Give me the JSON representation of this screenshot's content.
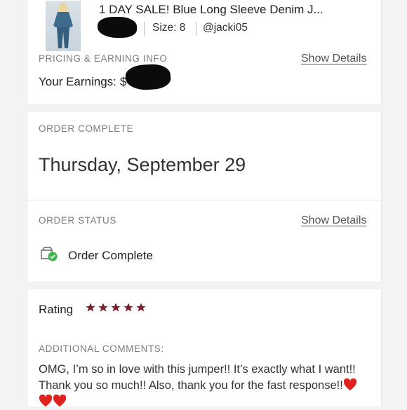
{
  "listing": {
    "title": "1 DAY SALE! Blue Long Sleeve Denim J...",
    "size": "Size: 8",
    "username": "@jacki05"
  },
  "pricing": {
    "heading": "PRICING & EARNING INFO",
    "show_details": "Show Details",
    "earnings_label": "Your Earnings:",
    "earnings_value_prefix": "$"
  },
  "order": {
    "complete_heading": "ORDER COMPLETE",
    "date": "Thursday, September 29",
    "status_heading": "ORDER STATUS",
    "show_details": "Show Details",
    "status": "Order Complete"
  },
  "rating": {
    "label": "Rating",
    "stars": 5,
    "star_color": "#7d1f2b"
  },
  "comments": {
    "heading": "ADDITIONAL COMMENTS:",
    "text": "OMG, I’m so in love with this jumper!! It’s exactly what I want!! Thank you so much!! Also, thank you for the fast response!!"
  }
}
